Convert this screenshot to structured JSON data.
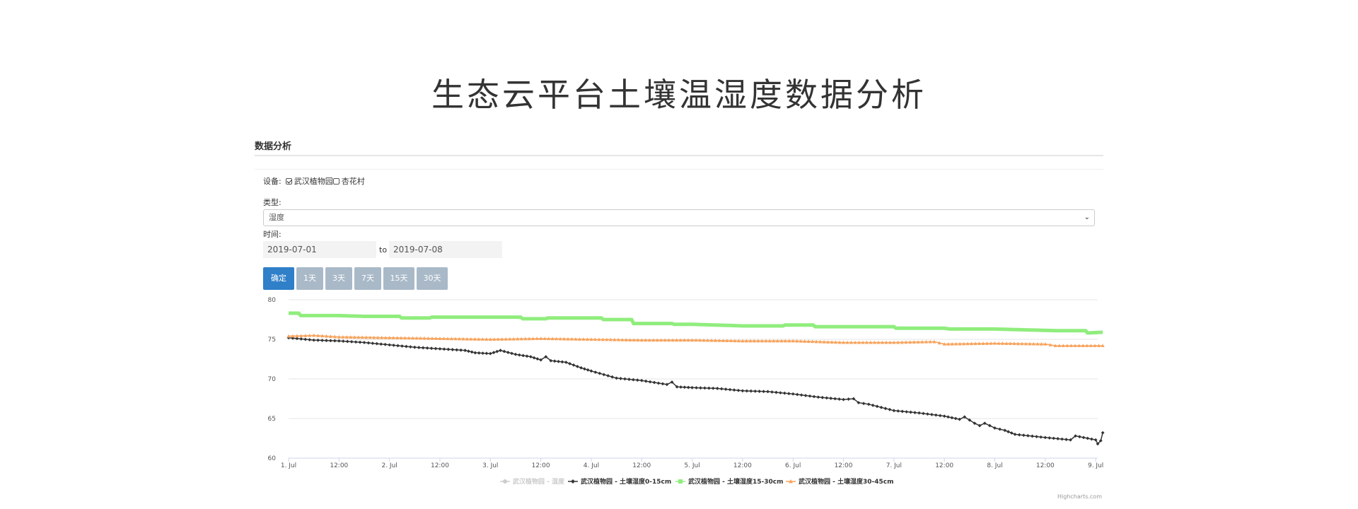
{
  "page": {
    "title": "生态云平台土壤温湿度数据分析"
  },
  "panel": {
    "heading": "数据分析"
  },
  "form": {
    "device_label": "设备:",
    "devices": [
      {
        "label": "武汉植物园",
        "checked": true
      },
      {
        "label": "杏花村",
        "checked": false
      }
    ],
    "type_label": "类型:",
    "type_value": "湿度",
    "time_label": "时间:",
    "date_from": "2019-07-01",
    "date_to_label": "to",
    "date_to": "2019-07-08"
  },
  "buttons": {
    "confirm": "确定",
    "ranges": [
      "1天",
      "3天",
      "7天",
      "15天",
      "30天"
    ]
  },
  "colors": {
    "primary": "#2f7fc9",
    "range_button": "#a9b9c8",
    "series_hidden": "#cccccc",
    "series_0_15": "#333333",
    "series_15_30": "#90ed7d",
    "series_30_45": "#f7a35c"
  },
  "chart_data": {
    "type": "line",
    "title": "",
    "xlabel": "",
    "ylabel": "",
    "ylim": [
      60,
      80
    ],
    "y_ticks": [
      60,
      65,
      70,
      75,
      80
    ],
    "xlim": [
      0,
      8.02
    ],
    "x_ticks": [
      {
        "x": 0,
        "label": "1. Jul"
      },
      {
        "x": 0.5,
        "label": "12:00"
      },
      {
        "x": 1,
        "label": "2. Jul"
      },
      {
        "x": 1.5,
        "label": "12:00"
      },
      {
        "x": 2,
        "label": "3. Jul"
      },
      {
        "x": 2.5,
        "label": "12:00"
      },
      {
        "x": 3,
        "label": "4. Jul"
      },
      {
        "x": 3.5,
        "label": "12:00"
      },
      {
        "x": 4,
        "label": "5. Jul"
      },
      {
        "x": 4.5,
        "label": "12:00"
      },
      {
        "x": 5,
        "label": "6. Jul"
      },
      {
        "x": 5.5,
        "label": "12:00"
      },
      {
        "x": 6,
        "label": "7. Jul"
      },
      {
        "x": 6.5,
        "label": "12:00"
      },
      {
        "x": 7,
        "label": "8. Jul"
      },
      {
        "x": 7.5,
        "label": "12:00"
      },
      {
        "x": 8,
        "label": "9. Jul"
      }
    ],
    "grid": true,
    "legend_position": "bottom-center",
    "credits": "Highcharts.com",
    "series": [
      {
        "name": "武汉植物园 - 湿度",
        "visible": false,
        "marker": "circle",
        "color": "#cccccc",
        "points": []
      },
      {
        "name": "武汉植物园 - 土壤湿度0-15cm",
        "visible": true,
        "marker": "diamond",
        "color": "#333333",
        "points": [
          [
            0.0,
            75.2
          ],
          [
            0.25,
            74.9
          ],
          [
            0.5,
            74.8
          ],
          [
            0.75,
            74.6
          ],
          [
            1.0,
            74.3
          ],
          [
            1.25,
            74.0
          ],
          [
            1.5,
            73.8
          ],
          [
            1.75,
            73.6
          ],
          [
            1.85,
            73.3
          ],
          [
            2.0,
            73.2
          ],
          [
            2.1,
            73.6
          ],
          [
            2.25,
            73.1
          ],
          [
            2.4,
            72.8
          ],
          [
            2.5,
            72.4
          ],
          [
            2.55,
            72.8
          ],
          [
            2.6,
            72.3
          ],
          [
            2.75,
            72.1
          ],
          [
            2.9,
            71.4
          ],
          [
            3.0,
            71.0
          ],
          [
            3.25,
            70.1
          ],
          [
            3.5,
            69.8
          ],
          [
            3.75,
            69.3
          ],
          [
            3.8,
            69.6
          ],
          [
            3.85,
            69.0
          ],
          [
            4.0,
            68.9
          ],
          [
            4.25,
            68.8
          ],
          [
            4.5,
            68.5
          ],
          [
            4.75,
            68.4
          ],
          [
            5.0,
            68.1
          ],
          [
            5.25,
            67.7
          ],
          [
            5.5,
            67.4
          ],
          [
            5.6,
            67.5
          ],
          [
            5.65,
            67.0
          ],
          [
            5.75,
            66.8
          ],
          [
            6.0,
            66.0
          ],
          [
            6.25,
            65.7
          ],
          [
            6.5,
            65.3
          ],
          [
            6.65,
            64.9
          ],
          [
            6.7,
            65.2
          ],
          [
            6.75,
            64.8
          ],
          [
            6.8,
            64.4
          ],
          [
            6.85,
            64.1
          ],
          [
            6.9,
            64.4
          ],
          [
            7.0,
            63.8
          ],
          [
            7.1,
            63.5
          ],
          [
            7.2,
            63.0
          ],
          [
            7.5,
            62.6
          ],
          [
            7.75,
            62.3
          ],
          [
            7.8,
            62.8
          ],
          [
            8.0,
            62.3
          ],
          [
            8.02,
            61.8
          ],
          [
            8.05,
            62.2
          ],
          [
            8.07,
            63.2
          ]
        ]
      },
      {
        "name": "武汉植物园 - 土壤湿度15-30cm",
        "visible": true,
        "marker": "square",
        "color": "#90ed7d",
        "points": [
          [
            0.0,
            78.3
          ],
          [
            0.1,
            78.3
          ],
          [
            0.12,
            78.0
          ],
          [
            0.5,
            78.0
          ],
          [
            0.75,
            77.9
          ],
          [
            1.1,
            77.9
          ],
          [
            1.12,
            77.7
          ],
          [
            1.4,
            77.7
          ],
          [
            1.42,
            77.8
          ],
          [
            2.0,
            77.8
          ],
          [
            2.3,
            77.8
          ],
          [
            2.32,
            77.6
          ],
          [
            2.55,
            77.6
          ],
          [
            2.57,
            77.7
          ],
          [
            3.0,
            77.7
          ],
          [
            3.1,
            77.7
          ],
          [
            3.12,
            77.5
          ],
          [
            3.4,
            77.5
          ],
          [
            3.42,
            77.0
          ],
          [
            3.8,
            77.0
          ],
          [
            3.82,
            76.9
          ],
          [
            4.0,
            76.9
          ],
          [
            4.5,
            76.7
          ],
          [
            4.9,
            76.7
          ],
          [
            4.92,
            76.8
          ],
          [
            5.2,
            76.8
          ],
          [
            5.22,
            76.6
          ],
          [
            5.7,
            76.6
          ],
          [
            6.0,
            76.6
          ],
          [
            6.02,
            76.4
          ],
          [
            6.5,
            76.4
          ],
          [
            6.55,
            76.3
          ],
          [
            7.0,
            76.3
          ],
          [
            7.3,
            76.2
          ],
          [
            7.6,
            76.1
          ],
          [
            7.9,
            76.1
          ],
          [
            7.92,
            75.8
          ],
          [
            8.07,
            75.9
          ]
        ]
      },
      {
        "name": "武汉植物园 - 土壤湿度30-45cm",
        "visible": true,
        "marker": "triangle",
        "color": "#f7a35c",
        "points": [
          [
            0.0,
            75.4
          ],
          [
            0.25,
            75.5
          ],
          [
            0.5,
            75.3
          ],
          [
            1.0,
            75.2
          ],
          [
            1.5,
            75.1
          ],
          [
            2.0,
            75.0
          ],
          [
            2.5,
            75.1
          ],
          [
            3.0,
            75.0
          ],
          [
            3.5,
            74.9
          ],
          [
            4.0,
            74.9
          ],
          [
            4.5,
            74.8
          ],
          [
            5.0,
            74.8
          ],
          [
            5.5,
            74.6
          ],
          [
            6.0,
            74.6
          ],
          [
            6.4,
            74.7
          ],
          [
            6.5,
            74.4
          ],
          [
            7.0,
            74.5
          ],
          [
            7.5,
            74.4
          ],
          [
            7.6,
            74.2
          ],
          [
            8.07,
            74.2
          ]
        ]
      }
    ]
  }
}
